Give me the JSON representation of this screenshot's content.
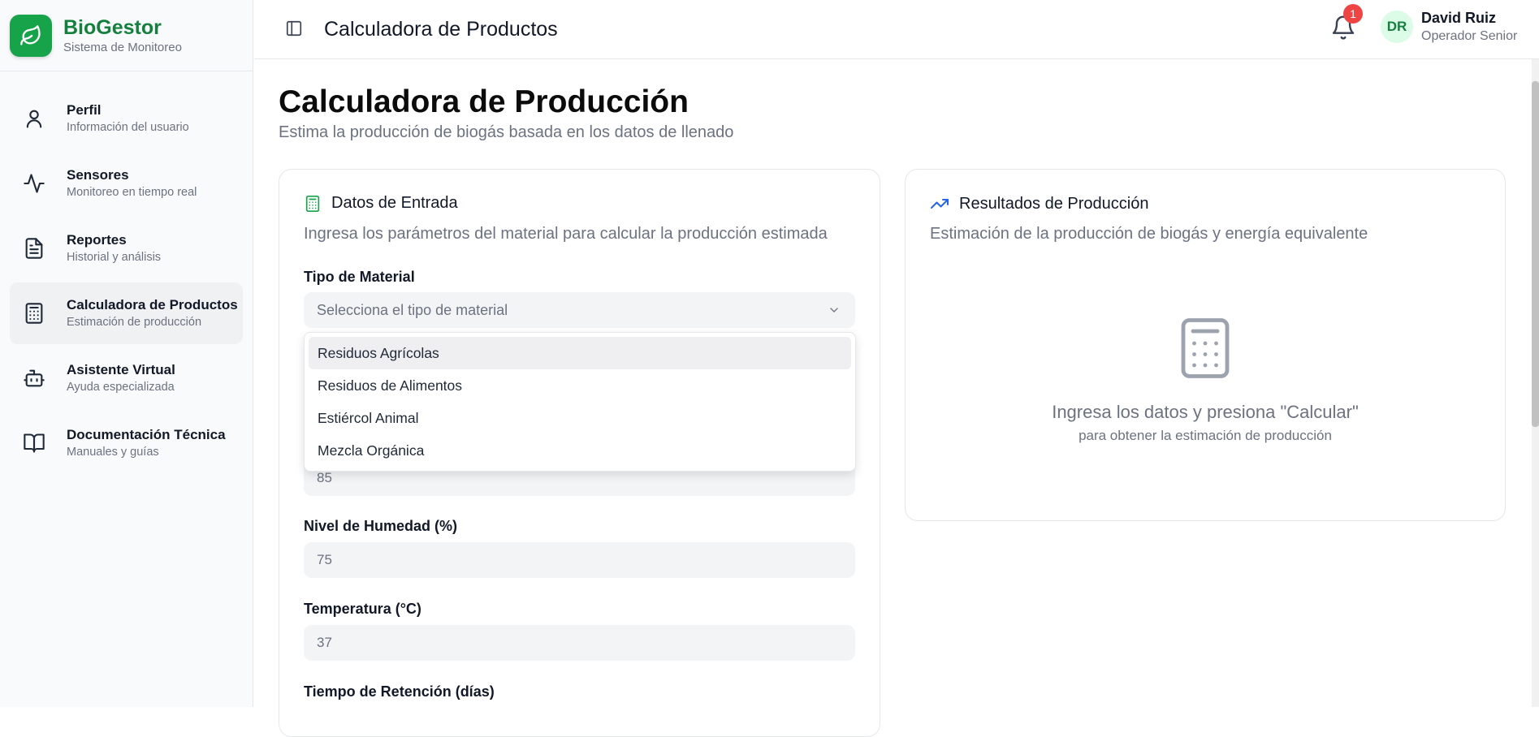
{
  "brand": {
    "name": "BioGestor",
    "subtitle": "Sistema de Monitoreo"
  },
  "sidebar": {
    "items": [
      {
        "label": "Perfil",
        "sub": "Información del usuario",
        "icon": "user-icon"
      },
      {
        "label": "Sensores",
        "sub": "Monitoreo en tiempo real",
        "icon": "activity-icon"
      },
      {
        "label": "Reportes",
        "sub": "Historial y análisis",
        "icon": "file-text-icon"
      },
      {
        "label": "Calculadora de Productos",
        "sub": "Estimación de producción",
        "icon": "calculator-icon",
        "active": true
      },
      {
        "label": "Asistente Virtual",
        "sub": "Ayuda especializada",
        "icon": "bot-icon"
      },
      {
        "label": "Documentación Técnica",
        "sub": "Manuales y guías",
        "icon": "book-open-icon"
      }
    ]
  },
  "header": {
    "title": "Calculadora de Productos",
    "notifications": "1",
    "user": {
      "initials": "DR",
      "name": "David Ruiz",
      "role": "Operador Senior"
    }
  },
  "main": {
    "title": "Calculadora de Producción",
    "subtitle": "Estima la producción de biogás basada en los datos de llenado"
  },
  "input_card": {
    "title": "Datos de Entrada",
    "description": "Ingresa los parámetros del material para calcular la producción estimada",
    "material": {
      "label": "Tipo de Material",
      "placeholder": "Selecciona el tipo de material",
      "options": [
        "Residuos Agrícolas",
        "Residuos de Alimentos",
        "Estiércol Animal",
        "Mezcla Orgánica"
      ]
    },
    "hidden_field": {
      "value": "85"
    },
    "humidity": {
      "label": "Nivel de Humedad (%)",
      "value": "75"
    },
    "temperature": {
      "label": "Temperatura (°C)",
      "value": "37"
    },
    "retention": {
      "label": "Tiempo de Retención (días)"
    }
  },
  "results_card": {
    "title": "Resultados de Producción",
    "description": "Estimación de la producción de biogás y energía equivalente",
    "empty_title": "Ingresa los datos y presiona \"Calcular\"",
    "empty_sub": "para obtener la estimación de producción"
  },
  "colors": {
    "brand": "#16a34a",
    "accent_blue": "#2563eb",
    "badge": "#ef4444"
  }
}
